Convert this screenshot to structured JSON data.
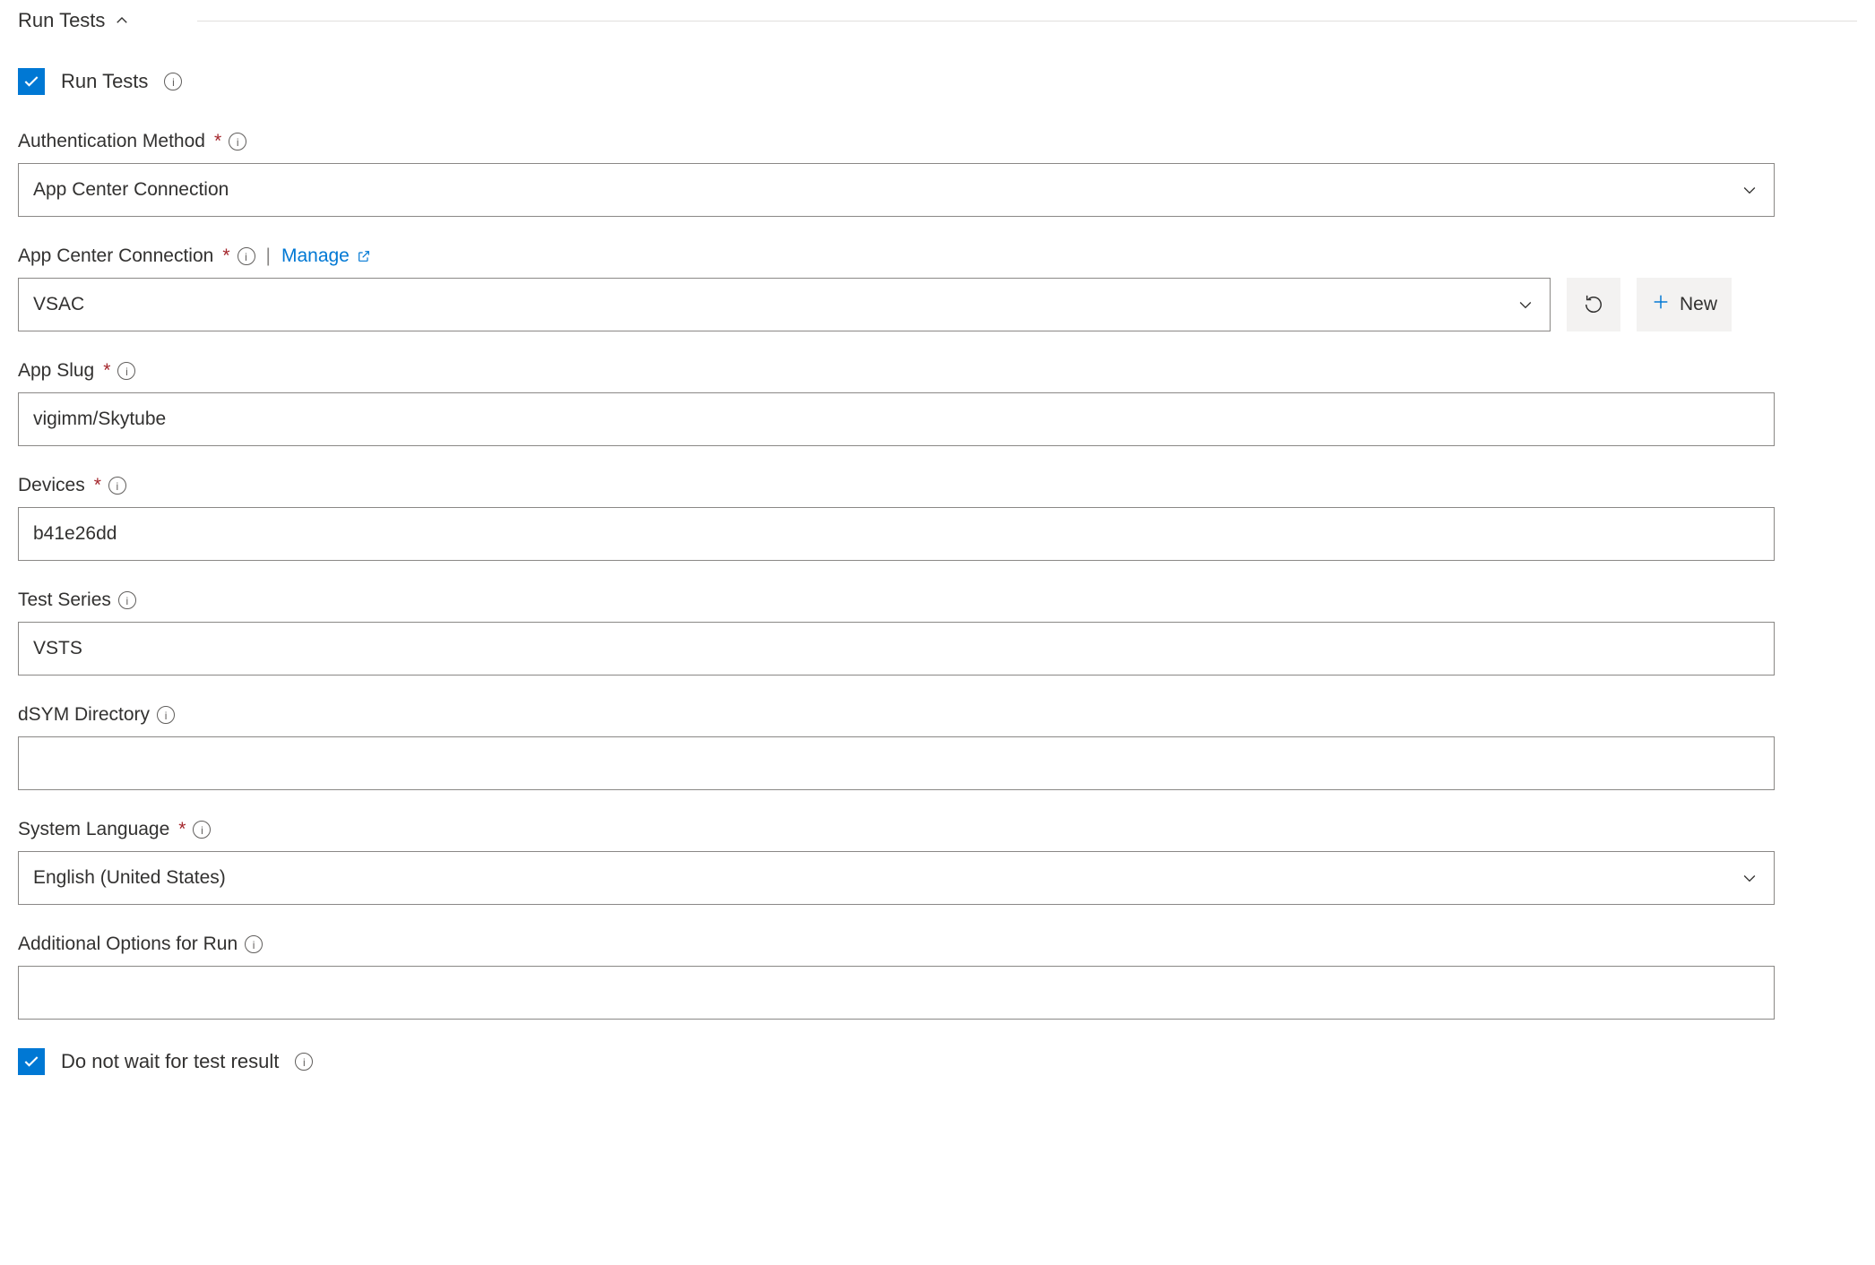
{
  "section": {
    "title": "Run Tests"
  },
  "checkbox_run_tests": {
    "label": "Run Tests",
    "checked": true
  },
  "auth_method": {
    "label": "Authentication Method",
    "required": true,
    "value": "App Center Connection"
  },
  "app_center_connection": {
    "label": "App Center Connection",
    "required": true,
    "manage": "Manage",
    "value": "VSAC",
    "new_label": "New"
  },
  "app_slug": {
    "label": "App Slug",
    "required": true,
    "value": "vigimm/Skytube"
  },
  "devices": {
    "label": "Devices",
    "required": true,
    "value": "b41e26dd"
  },
  "test_series": {
    "label": "Test Series",
    "required": false,
    "value": "VSTS"
  },
  "dsym": {
    "label": "dSYM Directory",
    "required": false,
    "value": ""
  },
  "system_language": {
    "label": "System Language",
    "required": true,
    "value": "English (United States)"
  },
  "additional_options": {
    "label": "Additional Options for Run",
    "required": false,
    "value": ""
  },
  "checkbox_wait": {
    "label": "Do not wait for test result",
    "checked": true
  }
}
